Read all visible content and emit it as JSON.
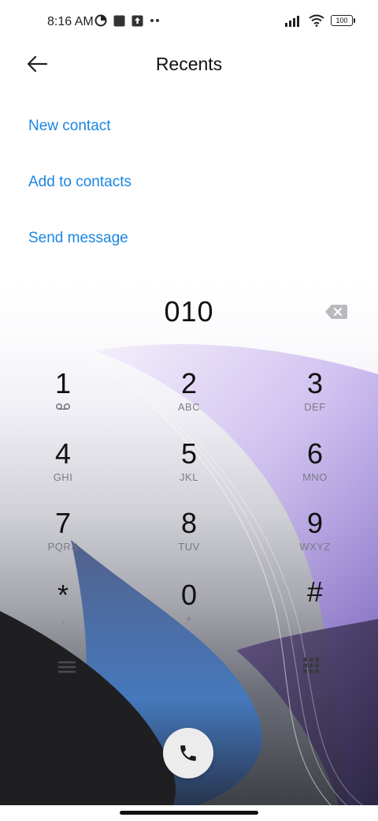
{
  "status_bar": {
    "time": "8:16 AM",
    "battery": "100",
    "icons": [
      "data-saver-icon",
      "square-notification-icon",
      "upload-notification-icon",
      "more-dots-icon",
      "signal-icon",
      "wifi-icon",
      "battery-icon"
    ]
  },
  "header": {
    "title": "Recents",
    "back_icon": "back-arrow-icon"
  },
  "actions": {
    "new_contact": "New contact",
    "add_to_contacts": "Add to contacts",
    "send_message": "Send message"
  },
  "dialpad": {
    "number": "010",
    "keys": [
      {
        "digit": "1",
        "letters": ""
      },
      {
        "digit": "2",
        "letters": "ABC"
      },
      {
        "digit": "3",
        "letters": "DEF"
      },
      {
        "digit": "4",
        "letters": "GHI"
      },
      {
        "digit": "5",
        "letters": "JKL"
      },
      {
        "digit": "6",
        "letters": "MNO"
      },
      {
        "digit": "7",
        "letters": "PQRS"
      },
      {
        "digit": "8",
        "letters": "TUV"
      },
      {
        "digit": "9",
        "letters": "WXYZ"
      },
      {
        "digit": "*",
        "letters": ","
      },
      {
        "digit": "0",
        "letters": "+"
      },
      {
        "digit": "#",
        "letters": ""
      }
    ]
  },
  "colors": {
    "accent": "#1a86e0",
    "call_button_bg": "#ececec"
  }
}
